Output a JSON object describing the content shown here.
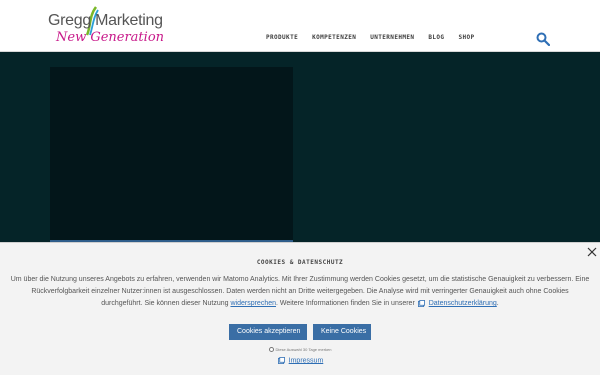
{
  "header": {
    "logo": {
      "brand": "Gregg Marketing",
      "tagline": "New Generation"
    },
    "nav": [
      "PRODUKTE",
      "KOMPETENZEN",
      "UNTERNEHMEN",
      "BLOG",
      "SHOP"
    ],
    "search_icon": "search-icon"
  },
  "colors": {
    "hero_bg": "#052428",
    "button": "#3a6ea5",
    "link": "#2f6fb5",
    "tagline": "#c8198a"
  },
  "cookie": {
    "title": "COOKIES & DATENSCHUTZ",
    "text_1": "Um über die Nutzung unseres Angebots zu erfahren, verwenden wir Matomo Analytics. Mit Ihrer Zustimmung werden Cookies gesetzt, um die statistische Genauigkeit zu verbessern. Eine Rückverfolgbarkeit einzelner Nutzer:innen ist ausgeschlossen. Daten werden nicht an Dritte weitergegeben. Die Analyse wird mit verringerter Genauigkeit auch ohne Cookies durchgeführt. Sie können dieser Nutzung",
    "link_object": "widersprechen",
    "text_2": ". Weitere Informationen finden Sie in unserer",
    "link_privacy": "Datenschutzerklärung",
    "text_3": ".",
    "accept_label": "Cookies akzeptieren",
    "deny_label": "Keine Cookies",
    "remember_label": "Diese Auswahl 30 Tage merken",
    "impressum_label": "Impressum"
  }
}
